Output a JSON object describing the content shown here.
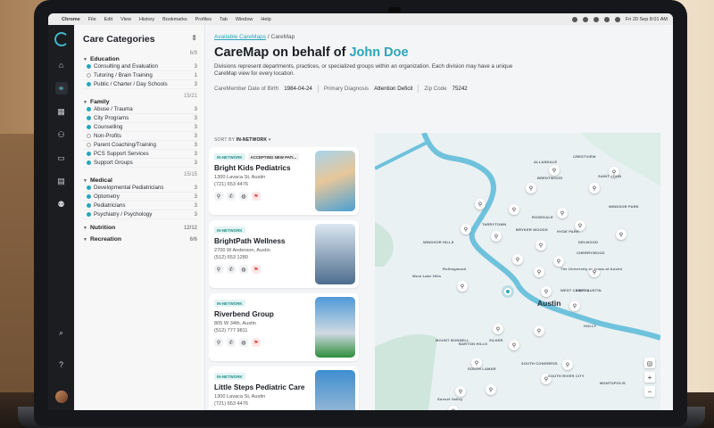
{
  "menubar": {
    "app": "Chrome",
    "menus": [
      "File",
      "Edit",
      "View",
      "History",
      "Bookmarks",
      "Profiles",
      "Tab",
      "Window",
      "Help"
    ],
    "clock": "Fri 20 Sep  8:01 AM"
  },
  "rail": {
    "icons": [
      "home-icon",
      "network-icon",
      "building-icon",
      "people-icon",
      "card-icon",
      "document-icon",
      "group-icon"
    ],
    "bottom": [
      "search-icon",
      "help-icon"
    ]
  },
  "categories": {
    "title": "Care Categories",
    "groups": [
      {
        "name": "Education",
        "count": "6/9",
        "items": [
          {
            "label": "Consulting and Evaluation",
            "count": "3",
            "checked": true
          },
          {
            "label": "Tutoring / Brain Training",
            "count": "1",
            "checked": false
          },
          {
            "label": "Public / Charter / Day Schools",
            "count": "3",
            "checked": true
          }
        ]
      },
      {
        "name": "Family",
        "count": "15/21",
        "items": [
          {
            "label": "Abuse / Trauma",
            "count": "3",
            "checked": true
          },
          {
            "label": "City Programs",
            "count": "3",
            "checked": true
          },
          {
            "label": "Counselling",
            "count": "3",
            "checked": true
          },
          {
            "label": "Non-Profits",
            "count": "3",
            "checked": false
          },
          {
            "label": "Parent Coaching/Training",
            "count": "3",
            "checked": false
          },
          {
            "label": "PCS Support Services",
            "count": "3",
            "checked": true
          },
          {
            "label": "Support Groups",
            "count": "3",
            "checked": true
          }
        ]
      },
      {
        "name": "Medical",
        "count": "15/15",
        "items": [
          {
            "label": "Developmental Pediatricians",
            "count": "3",
            "checked": true
          },
          {
            "label": "Optometry",
            "count": "3",
            "checked": true
          },
          {
            "label": "Pediatricians",
            "count": "3",
            "checked": true
          },
          {
            "label": "Psychiatry / Psychology",
            "count": "3",
            "checked": true
          }
        ]
      },
      {
        "name": "Nutrition",
        "count": "12/12",
        "items": []
      },
      {
        "name": "Recreation",
        "count": "6/6",
        "items": []
      }
    ]
  },
  "main": {
    "breadcrumb_link": "Available CareMaps",
    "breadcrumb_sep": "/",
    "breadcrumb_current": "CareMap",
    "title_prefix": "CareMap on behalf of",
    "title_name": "John Doe",
    "description": "Divisions represent departments, practices, or specialized groups within an organization. Each division may have a unique CareMap view for every location.",
    "facts": [
      {
        "label": "CareMember Date of Birth",
        "value": "1984-04-24"
      },
      {
        "label": "Primary Diagnosis",
        "value": "Attention Deficit"
      },
      {
        "label": "Zip Code",
        "value": "75242"
      }
    ],
    "sort_label": "SORT BY",
    "sort_value": "IN-NETWORK"
  },
  "providers": [
    {
      "badges": [
        "IN-NETWORK",
        "ACCEPTING NEW PATI..."
      ],
      "name": "Bright Kids Pediatrics",
      "addr1": "1300 Lavaca St, Austin",
      "phone": "(721) 653 4476"
    },
    {
      "badges": [
        "IN-NETWORK"
      ],
      "name": "BrightPath Wellness",
      "addr1": "2700 W Anderson, Austin",
      "phone": "(512) 653 1280"
    },
    {
      "badges": [
        "IN-NETWORK"
      ],
      "name": "Riverbend Group",
      "addr1": "805 W 34th, Austin",
      "phone": "(512) 777 9811"
    },
    {
      "badges": [
        "IN-NETWORK"
      ],
      "name": "Little Steps Pediatric Care",
      "addr1": "1300 Lavaca St, Austin",
      "phone": "(721) 653 4476"
    }
  ],
  "map": {
    "city": "Austin",
    "labels": [
      "ALLANDALE",
      "CRESTVIEW",
      "BRENTWOOD",
      "SAINT JOHN",
      "WINDSOR PARK",
      "ROSEDALE",
      "HYDE PARK",
      "WINDSOR HILLS",
      "TARRYTOWN",
      "BRYKER WOODS",
      "DELWOOD",
      "CHERRYWOOD",
      "The University of Texas at Austin",
      "WEST CAMPUS",
      "EAST AUSTIN",
      "ZILKER",
      "BARTON HILLS",
      "SOUTH LAMAR",
      "SOUTH CONGRESS",
      "MONTOPOLIS",
      "SOUTH RIVER CITY",
      "Rollingwood",
      "West Lake Hills",
      "Sunset Valley",
      "MOUNT BONNELL",
      "HOLLY"
    ],
    "zoom_in": "+",
    "zoom_out": "−"
  }
}
